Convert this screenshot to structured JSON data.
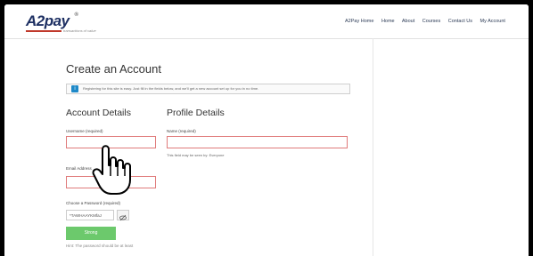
{
  "header": {
    "logo_text": "A2pay",
    "logo_reg": "®",
    "logo_tagline": "transactions of value",
    "nav": [
      "A2Pay Home",
      "Home",
      "About",
      "Courses",
      "Contact Us",
      "My Account"
    ]
  },
  "main": {
    "title": "Create an Account",
    "info_text": "Registering for this site is easy. Just fill in the fields below, and we'll get a new account set up for you in no time.",
    "account_details": {
      "heading": "Account Details",
      "username_label": "Username (required)",
      "email_label": "Email Address",
      "password_label": "Choose a Password (required)",
      "password_value": "*TAWHAAYKMfaJ",
      "strength_label": "Strong",
      "password_hint": "Hint: The password should be at least"
    },
    "profile_details": {
      "heading": "Profile Details",
      "name_label": "Name (required)",
      "visibility_hint": "This field may be seen by: Everyone"
    }
  },
  "icons": {
    "info": "info-icon",
    "eye": "eye-slash-icon",
    "cursor": "hand-pointer-icon"
  },
  "colors": {
    "brand_navy": "#1d2f62",
    "brand_red": "#c0392b",
    "error_border": "#e07b7b",
    "strength_green": "#6cc96c",
    "info_blue": "#1e89c8"
  }
}
